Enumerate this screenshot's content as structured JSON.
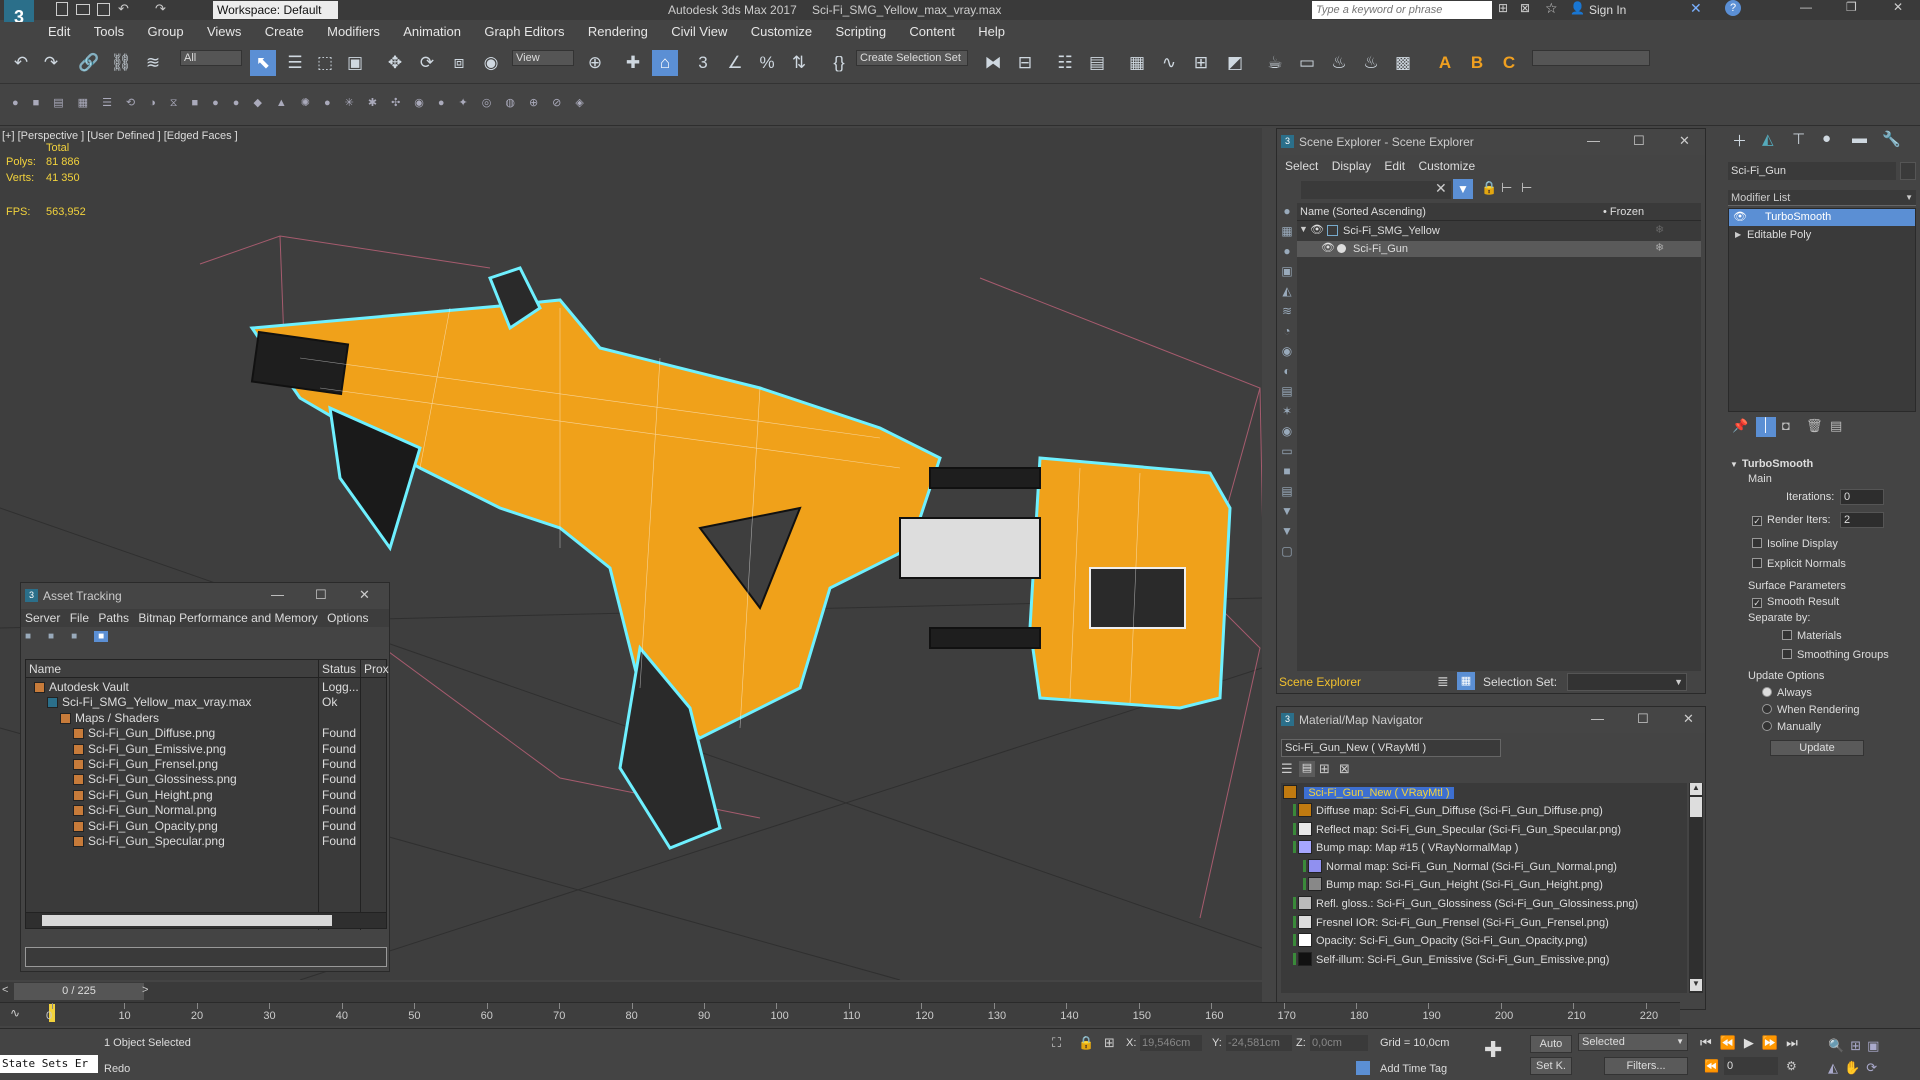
{
  "titlebar": {
    "workspace": "Workspace: Default",
    "app_title": "Autodesk 3ds Max 2017",
    "file_title": "Sci-Fi_SMG_Yellow_max_vray.max",
    "search_placeholder": "Type a keyword or phrase",
    "sign_in": "Sign In"
  },
  "menu": [
    "Edit",
    "Tools",
    "Group",
    "Views",
    "Create",
    "Modifiers",
    "Animation",
    "Graph Editors",
    "Rendering",
    "Civil View",
    "Customize",
    "Scripting",
    "Content",
    "Help"
  ],
  "toolbar": {
    "filter": "All",
    "ref_coord": "View",
    "selection_set": "Create Selection Set"
  },
  "viewport": {
    "label": "[+] [Perspective ] [User Defined ] [Edged Faces ]",
    "stats_header": "Total",
    "polys_label": "Polys:",
    "polys_value": "81 886",
    "verts_label": "Verts:",
    "verts_value": "41 350",
    "fps_label": "FPS:",
    "fps_value": "563,952"
  },
  "asset_tracking": {
    "title": "Asset Tracking",
    "menu": [
      "Server",
      "File",
      "Paths",
      "Bitmap Performance and Memory",
      "Options"
    ],
    "columns": [
      "Name",
      "Status",
      "Prox"
    ],
    "rows": [
      {
        "name": "Autodesk Vault",
        "status": "Logg...",
        "indent": 0
      },
      {
        "name": "Sci-Fi_SMG_Yellow_max_vray.max",
        "status": "Ok",
        "indent": 1
      },
      {
        "name": "Maps / Shaders",
        "status": "",
        "indent": 2
      },
      {
        "name": "Sci-Fi_Gun_Diffuse.png",
        "status": "Found",
        "indent": 3
      },
      {
        "name": "Sci-Fi_Gun_Emissive.png",
        "status": "Found",
        "indent": 3
      },
      {
        "name": "Sci-Fi_Gun_Frensel.png",
        "status": "Found",
        "indent": 3
      },
      {
        "name": "Sci-Fi_Gun_Glossiness.png",
        "status": "Found",
        "indent": 3
      },
      {
        "name": "Sci-Fi_Gun_Height.png",
        "status": "Found",
        "indent": 3
      },
      {
        "name": "Sci-Fi_Gun_Normal.png",
        "status": "Found",
        "indent": 3
      },
      {
        "name": "Sci-Fi_Gun_Opacity.png",
        "status": "Found",
        "indent": 3
      },
      {
        "name": "Sci-Fi_Gun_Specular.png",
        "status": "Found",
        "indent": 3
      }
    ]
  },
  "scene_explorer": {
    "title": "Scene Explorer - Scene Explorer",
    "menu": [
      "Select",
      "Display",
      "Edit",
      "Customize"
    ],
    "col_name": "Name (Sorted Ascending)",
    "col_frozen": "• Frozen",
    "items": [
      {
        "name": "Sci-Fi_SMG_Yellow",
        "selected": false
      },
      {
        "name": "Sci-Fi_Gun",
        "selected": true
      }
    ],
    "footer_label": "Scene Explorer",
    "selection_set_label": "Selection Set:"
  },
  "material_navigator": {
    "title": "Material/Map Navigator",
    "current": "Sci-Fi_Gun_New  ( VRayMtl )",
    "root": "Sci-Fi_Gun_New  ( VRayMtl )",
    "items": [
      {
        "label": "Diffuse map: Sci-Fi_Gun_Diffuse (Sci-Fi_Gun_Diffuse.png)",
        "indent": 0,
        "color": "#c07a10"
      },
      {
        "label": "Reflect map: Sci-Fi_Gun_Specular (Sci-Fi_Gun_Specular.png)",
        "indent": 0,
        "color": "#e8e8e8"
      },
      {
        "label": "Bump map: Map #15  ( VRayNormalMap )",
        "indent": 0,
        "color": "#a6a6ff"
      },
      {
        "label": "Normal map: Sci-Fi_Gun_Normal (Sci-Fi_Gun_Normal.png)",
        "indent": 1,
        "color": "#9090f0"
      },
      {
        "label": "Bump map: Sci-Fi_Gun_Height (Sci-Fi_Gun_Height.png)",
        "indent": 1,
        "color": "#888888"
      },
      {
        "label": "Refl. gloss.: Sci-Fi_Gun_Glossiness (Sci-Fi_Gun_Glossiness.png)",
        "indent": 0,
        "color": "#bbbbbb"
      },
      {
        "label": "Fresnel IOR: Sci-Fi_Gun_Frensel (Sci-Fi_Gun_Frensel.png)",
        "indent": 0,
        "color": "#dddddd"
      },
      {
        "label": "Opacity: Sci-Fi_Gun_Opacity (Sci-Fi_Gun_Opacity.png)",
        "indent": 0,
        "color": "#ffffff"
      },
      {
        "label": "Self-illum: Sci-Fi_Gun_Emissive (Sci-Fi_Gun_Emissive.png)",
        "indent": 0,
        "color": "#111111"
      }
    ]
  },
  "command_panel": {
    "object_name": "Sci-Fi_Gun",
    "modifier_list": "Modifier List",
    "stack": [
      {
        "name": "TurboSmooth",
        "selected": true
      },
      {
        "name": "Editable Poly",
        "selected": false
      }
    ],
    "rollout_title": "TurboSmooth",
    "main": "Main",
    "iterations_label": "Iterations:",
    "iterations_value": "0",
    "render_iters_label": "Render Iters:",
    "render_iters_value": "2",
    "isoline": "Isoline Display",
    "explicit_normals": "Explicit Normals",
    "surface_params": "Surface Parameters",
    "smooth_result": "Smooth Result",
    "separate_by": "Separate by:",
    "materials": "Materials",
    "smoothing_groups": "Smoothing Groups",
    "update_options": "Update Options",
    "always": "Always",
    "when_rendering": "When Rendering",
    "manually": "Manually",
    "update": "Update"
  },
  "timeline": {
    "frame": "0 / 225",
    "ticks": [
      "0",
      "10",
      "20",
      "30",
      "40",
      "50",
      "60",
      "70",
      "80",
      "90",
      "100",
      "110",
      "120",
      "130",
      "140",
      "150",
      "160",
      "170",
      "180",
      "190",
      "200",
      "210",
      "220"
    ]
  },
  "statusbar": {
    "state_sets": "State Sets Er",
    "selected": "1 Object Selected",
    "redo": "Redo",
    "x_label": "X:",
    "x_value": "19,546cm",
    "y_label": "Y:",
    "y_value": "-24,581cm",
    "z_label": "Z:",
    "z_value": "0,0cm",
    "grid": "Grid = 10,0cm",
    "add_time_tag": "Add Time Tag",
    "auto": "Auto",
    "set_k": "Set K.",
    "selected_dd": "Selected",
    "filters": "Filters...",
    "frame_value": "0"
  }
}
